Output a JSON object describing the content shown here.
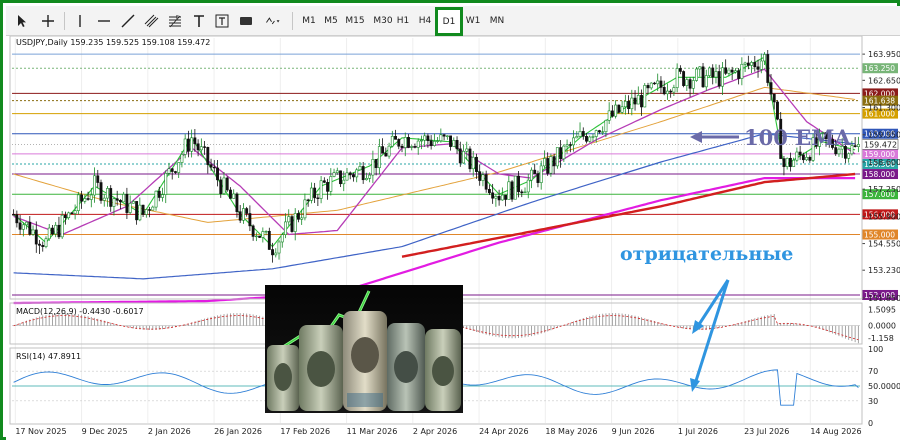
{
  "toolbar": {
    "timeframes": [
      "M1",
      "M5",
      "M15",
      "M30",
      "H1",
      "H4",
      "D1",
      "W1",
      "MN"
    ],
    "active_timeframe": "D1",
    "tools": [
      "cursor-icon",
      "crosshair-icon",
      "vertical-line-icon",
      "horizontal-line-icon",
      "trendline-icon",
      "fibonacci-icon",
      "equidistant-channel-icon",
      "text-icon",
      "text-label-icon",
      "rectangle-icon",
      "shapes-menu-icon"
    ]
  },
  "colors": {
    "frame": "#118a1e",
    "bull": "#168a27",
    "bear": "#111111",
    "ema_fast": "#2ec23a",
    "ema_mid": "#b63cb6",
    "ema100": "#3f63c6",
    "sma_orange": "#e3a23b",
    "ma_magenta": "#e21ce2",
    "ma_red": "#d21f1f",
    "annotation_blue": "#2f95e0",
    "annotation_ema": "#6a6aa8"
  },
  "chart_data": {
    "type": "candlestick",
    "title": "USDJPY,Daily",
    "ohlc_text": "159.235 159.525 159.108 159.472",
    "x_labels": [
      "17 Nov 2025",
      "9 Dec 2025",
      "2 Jan 2026",
      "26 Jan 2026",
      "17 Feb 2026",
      "11 Mar 2026",
      "2 Apr 2026",
      "24 Apr 2026",
      "18 May 2026",
      "9 Jun 2026",
      "1 Jul 2026",
      "23 Jul 2026",
      "14 Aug 2026"
    ],
    "price_ticks": [
      "163.950",
      "162.650",
      "161.300",
      "159.950",
      "158.600",
      "157.250",
      "155.900",
      "154.550",
      "153.230",
      "151.850"
    ],
    "ylim": [
      151.85,
      164.75
    ],
    "ema_markers": [
      161.0,
      158.6
    ],
    "indicators": {
      "ema100": {
        "values": [
          [
            0,
            153.1
          ],
          [
            40,
            152.8
          ],
          [
            80,
            153.3
          ],
          [
            120,
            154.4
          ],
          [
            160,
            156.6
          ],
          [
            200,
            158.6
          ],
          [
            232,
            160.0
          ],
          [
            260,
            159.5
          ]
        ]
      },
      "ma_magenta": {
        "values": [
          [
            0,
            151.6
          ],
          [
            60,
            151.7
          ],
          [
            100,
            152.1
          ],
          [
            150,
            154.6
          ],
          [
            200,
            156.7
          ],
          [
            232,
            157.8
          ],
          [
            260,
            157.8
          ]
        ]
      },
      "ma_red": {
        "values": [
          [
            120,
            153.9
          ],
          [
            200,
            156.4
          ],
          [
            232,
            157.6
          ],
          [
            260,
            158.0
          ]
        ]
      },
      "sma_orange": {
        "values": [
          [
            0,
            158.0
          ],
          [
            30,
            156.6
          ],
          [
            60,
            155.6
          ],
          [
            100,
            156.2
          ],
          [
            150,
            158.1
          ],
          [
            200,
            160.6
          ],
          [
            232,
            162.3
          ],
          [
            260,
            161.7
          ]
        ]
      },
      "ema_mid": {
        "values": [
          [
            0,
            155.9
          ],
          [
            15,
            155.0
          ],
          [
            35,
            156.4
          ],
          [
            55,
            159.3
          ],
          [
            70,
            157.4
          ],
          [
            85,
            155.0
          ],
          [
            100,
            155.2
          ],
          [
            120,
            159.3
          ],
          [
            135,
            159.5
          ],
          [
            150,
            158.0
          ],
          [
            160,
            157.8
          ],
          [
            180,
            159.7
          ],
          [
            200,
            161.2
          ],
          [
            215,
            162.2
          ],
          [
            232,
            163.2
          ],
          [
            245,
            160.6
          ],
          [
            260,
            159.0
          ]
        ]
      },
      "ema_fast": {
        "values": [
          [
            0,
            156.0
          ],
          [
            10,
            154.6
          ],
          [
            25,
            157.4
          ],
          [
            40,
            156.0
          ],
          [
            55,
            159.8
          ],
          [
            70,
            156.0
          ],
          [
            80,
            154.4
          ],
          [
            95,
            157.4
          ],
          [
            110,
            158.4
          ],
          [
            120,
            159.8
          ],
          [
            135,
            159.6
          ],
          [
            150,
            157.0
          ],
          [
            160,
            157.7
          ],
          [
            175,
            159.8
          ],
          [
            190,
            161.4
          ],
          [
            205,
            162.8
          ],
          [
            220,
            162.8
          ],
          [
            232,
            163.8
          ],
          [
            238,
            158.4
          ],
          [
            250,
            159.6
          ],
          [
            260,
            159.2
          ]
        ]
      }
    },
    "horizontal_levels": [
      {
        "price": 163.95,
        "color": "#7aa2d8",
        "label": "163.950",
        "style": "solid",
        "badge": false
      },
      {
        "price": 163.25,
        "color": "#78b578",
        "label": "163.250",
        "style": "dotted",
        "badge": true
      },
      {
        "price": 162.0,
        "color": "#8b1a1a",
        "label": "162.000",
        "style": "solid",
        "badge": true
      },
      {
        "price": 161.64,
        "color": "#8a6d10",
        "label": "161.638",
        "style": "dotted",
        "badge": true
      },
      {
        "price": 161.0,
        "color": "#d4a000",
        "label": "161.000",
        "style": "solid",
        "badge": true
      },
      {
        "price": 160.0,
        "color": "#2f56b8",
        "label": "160.000",
        "style": "solid",
        "badge": true
      },
      {
        "price": 159.0,
        "color": "#d97ad9",
        "label": "159.000",
        "style": "solid",
        "badge": true
      },
      {
        "price": 158.5,
        "color": "#2aa5a5",
        "label": "158.500",
        "style": "dotted",
        "badge": true
      },
      {
        "price": 158.0,
        "color": "#7a1a8a",
        "label": "158.000",
        "style": "solid",
        "badge": true
      },
      {
        "price": 157.0,
        "color": "#3cb43c",
        "label": "157.000",
        "style": "solid",
        "badge": true
      },
      {
        "price": 156.0,
        "color": "#c01818",
        "label": "156.000",
        "style": "solid",
        "badge": true
      },
      {
        "price": 155.0,
        "color": "#e0862a",
        "label": "155.000",
        "style": "solid",
        "badge": true
      },
      {
        "price": 152.0,
        "color": "#7a1a8a",
        "label": "152.000",
        "style": "solid",
        "badge": true
      }
    ],
    "last_price": {
      "value": 159.472,
      "label": "159.472"
    },
    "macd": {
      "title": "MACD(12,26,9) -0.4430 -0.6017",
      "ticks": [
        "1.5095",
        "0.0000",
        "-1.158"
      ],
      "ylim": [
        -1.6,
        2.0
      ]
    },
    "rsi": {
      "title": "RSI(14) 47.8911",
      "ticks": [
        "100",
        "70",
        "50.0000",
        "30",
        "0"
      ],
      "ylim": [
        0,
        100
      ],
      "level": 50
    }
  },
  "annotations": {
    "ema_label": "100 EMA",
    "negative_label": "отрицательные"
  }
}
